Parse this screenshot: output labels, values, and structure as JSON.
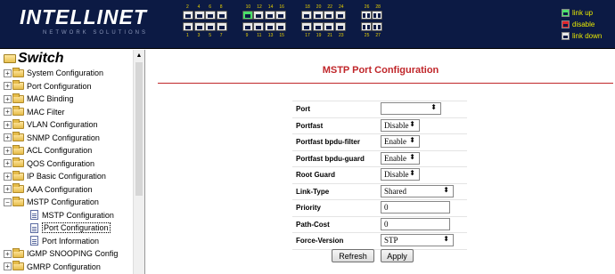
{
  "header": {
    "logo_text": "INTELLINET",
    "logo_tagline": "NETWORK SOLUTIONS",
    "port_numbers_top": [
      "2",
      "4",
      "6",
      "8",
      "10",
      "12",
      "14",
      "16",
      "18",
      "20",
      "22",
      "24",
      "26",
      "28"
    ],
    "port_numbers_bottom": [
      "1",
      "3",
      "5",
      "7",
      "9",
      "11",
      "13",
      "15",
      "17",
      "19",
      "21",
      "23",
      "25",
      "27"
    ],
    "legend": [
      {
        "label": "link up",
        "color": "#4be06a"
      },
      {
        "label": "disable",
        "color": "#e0242c"
      },
      {
        "label": "link down",
        "color": "#e8e8e8"
      }
    ]
  },
  "sidebar": {
    "root": "Switch",
    "items": [
      {
        "label": "System Configuration",
        "type": "folder",
        "expander": "+"
      },
      {
        "label": "Port Configuration",
        "type": "folder",
        "expander": "+"
      },
      {
        "label": "MAC Binding",
        "type": "folder",
        "expander": "+"
      },
      {
        "label": "MAC Filter",
        "type": "folder",
        "expander": "+"
      },
      {
        "label": "VLAN Configuration",
        "type": "folder",
        "expander": "+"
      },
      {
        "label": "SNMP Configuration",
        "type": "folder",
        "expander": "+"
      },
      {
        "label": "ACL Configuration",
        "type": "folder",
        "expander": "+"
      },
      {
        "label": "QOS Configuration",
        "type": "folder",
        "expander": "+"
      },
      {
        "label": "IP Basic Configuration",
        "type": "folder",
        "expander": "+"
      },
      {
        "label": "AAA Configuration",
        "type": "folder",
        "expander": "+"
      },
      {
        "label": "MSTP Configuration",
        "type": "folder",
        "expander": "−"
      },
      {
        "label": "MSTP Configuration",
        "type": "page"
      },
      {
        "label": "Port Configuration",
        "type": "page",
        "selected": true
      },
      {
        "label": "Port Information",
        "type": "page"
      },
      {
        "label": "IGMP SNOOPING Config",
        "type": "folder",
        "expander": "+"
      },
      {
        "label": "GMRP Configuration",
        "type": "folder",
        "expander": "+"
      }
    ]
  },
  "main": {
    "title": "MSTP Port Configuration",
    "fields": [
      {
        "label": "Port",
        "kind": "select",
        "value": ""
      },
      {
        "label": "Portfast",
        "kind": "select",
        "value": "Disable"
      },
      {
        "label": "Portfast bpdu-filter",
        "kind": "select",
        "value": "Enable"
      },
      {
        "label": "Portfast bpdu-guard",
        "kind": "select",
        "value": "Enable"
      },
      {
        "label": "Root Guard",
        "kind": "select",
        "value": "Disable"
      },
      {
        "label": "Link-Type",
        "kind": "select",
        "value": "Shared"
      },
      {
        "label": "Priority",
        "kind": "text",
        "value": "0"
      },
      {
        "label": "Path-Cost",
        "kind": "text",
        "value": "0"
      },
      {
        "label": "Force-Version",
        "kind": "select",
        "value": "STP"
      }
    ],
    "refresh_label": "Refresh",
    "apply_label": "Apply"
  }
}
